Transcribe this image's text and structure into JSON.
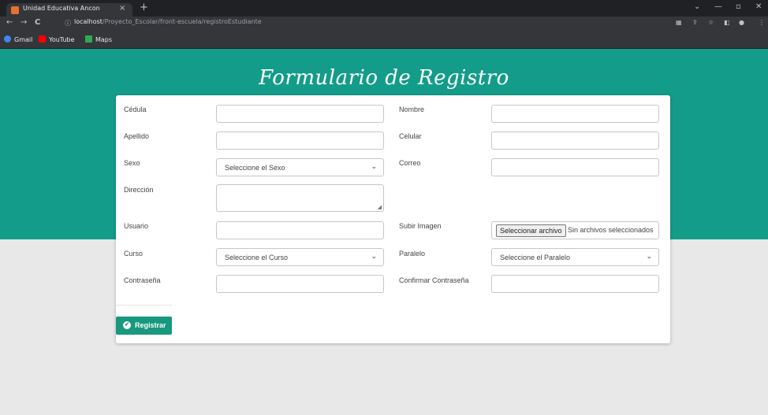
{
  "browser": {
    "tab_title": "Unidad Educativa Ancon",
    "tab_close": "×",
    "new_tab": "+",
    "url_host": "localhost",
    "url_path": "/Proyecto_Escolar/front-escuela/registroEstudiante",
    "bookmarks": [
      {
        "label": "Gmail",
        "icon": "google-icon",
        "color": "#4285f4"
      },
      {
        "label": "YouTube",
        "icon": "youtube-icon",
        "color": "#ff0000"
      },
      {
        "label": "Maps",
        "icon": "maps-icon",
        "color": "#34a853"
      }
    ]
  },
  "page": {
    "title": "Formulario de Registro",
    "accent_color": "#149c8a",
    "button_color": "#17987f"
  },
  "form": {
    "cedula_label": "Cédula",
    "nombre_label": "Nombre",
    "apellido_label": "Apellido",
    "celular_label": "Celular",
    "sexo_label": "Sexo",
    "sexo_value": "Seleccione el Sexo",
    "correo_label": "Correo",
    "direccion_label": "Dirección",
    "usuario_label": "Usuario",
    "imagen_label": "Subir Imagen",
    "file_button": "Seleccionar archivo",
    "file_status": "Sin archivos seleccionados",
    "curso_label": "Curso",
    "curso_value": "Seleccione el Curso",
    "paralelo_label": "Paralelo",
    "paralelo_value": "Seleccione el Paralelo",
    "contrasena_label": "Contraseña",
    "confirmar_label": "Confirmar Contraseña",
    "submit_label": "Registrar"
  }
}
